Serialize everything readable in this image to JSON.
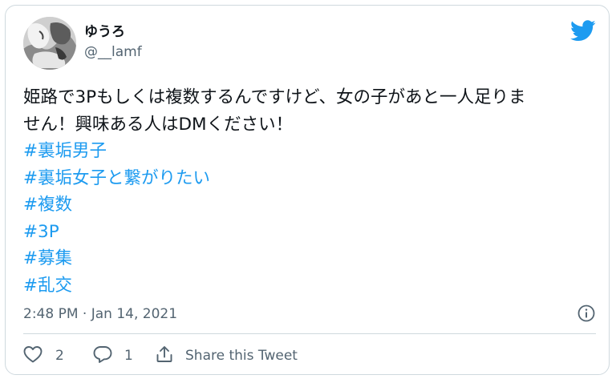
{
  "author": {
    "display_name": "ゆうろ",
    "handle": "@__lamf"
  },
  "tweet": {
    "text_lines": [
      "姫路で3Pもしくは複数するんですけど、女の子があと一人足りま",
      "せん！興味ある人はDMください！"
    ],
    "hashtags": [
      "#裏垢男子",
      "#裏垢女子と繋がりたい",
      "#複数",
      "#3P",
      "#募集",
      "#乱交"
    ],
    "timestamp": "2:48 PM · Jan 14, 2021"
  },
  "actions": {
    "like_count": "2",
    "reply_count": "1",
    "share_label": "Share this Tweet"
  },
  "colors": {
    "brand": "#1d9bf0",
    "text": "#0f1419",
    "muted": "#536471",
    "border": "#cfd9de"
  },
  "icons": {
    "brand": "twitter-bird-icon",
    "info": "info-icon",
    "like": "heart-icon",
    "reply": "reply-icon",
    "share": "share-icon"
  }
}
